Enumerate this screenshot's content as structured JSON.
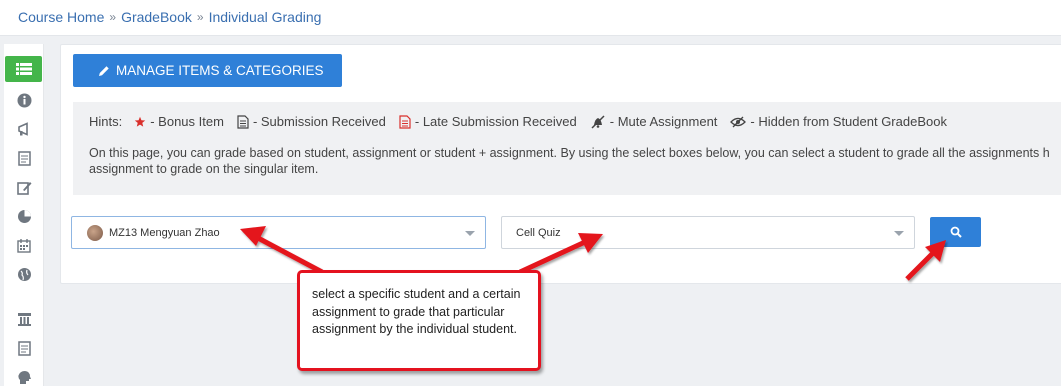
{
  "breadcrumb": {
    "items": [
      "Course Home",
      "GradeBook",
      "Individual Grading"
    ],
    "separator": "»"
  },
  "sidebar": {
    "items": [
      {
        "icon": "list-icon",
        "active": true
      },
      {
        "icon": "info-icon"
      },
      {
        "icon": "megaphone-icon"
      },
      {
        "icon": "document-icon"
      },
      {
        "icon": "edit-icon"
      },
      {
        "icon": "pie-chart-icon"
      },
      {
        "icon": "calendar-icon"
      },
      {
        "icon": "globe-icon"
      },
      {
        "icon": "pillar-icon"
      },
      {
        "icon": "document-icon"
      },
      {
        "icon": "head-icon"
      }
    ],
    "active_color": "#44b54a"
  },
  "toolbar": {
    "manage_label": "MANAGE ITEMS & CATEGORIES"
  },
  "hints": {
    "label": "Hints:",
    "items": [
      {
        "icon": "star-icon",
        "text": "- Bonus Item"
      },
      {
        "icon": "submission-icon",
        "text": "- Submission Received"
      },
      {
        "icon": "late-submission-icon",
        "text": "- Late Submission Received"
      },
      {
        "icon": "mute-icon",
        "text": "- Mute Assignment"
      },
      {
        "icon": "hidden-icon",
        "text": "- Hidden from Student GradeBook"
      }
    ],
    "description": "On this page, you can grade based on student, assignment or student + assignment. By using the select boxes below, you can select a student to grade all the assignments h assignment to grade on the singular item."
  },
  "filters": {
    "student_value": "MZ13 Mengyuan Zhao",
    "assignment_value": "Cell Quiz"
  },
  "annotation": {
    "text": "select a specific student and a certain assignment to grade that particular assignment by the individual student."
  },
  "colors": {
    "primary": "#2f80d8",
    "link": "#3a6fb0",
    "annotation_red": "#e4121f",
    "star": "#d9302c"
  }
}
